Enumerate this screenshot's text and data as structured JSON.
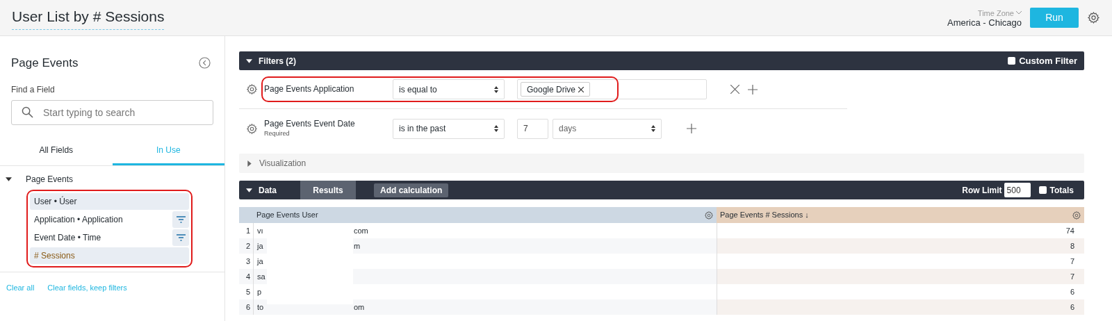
{
  "header": {
    "title": "User List by # Sessions",
    "time_zone_label": "Time Zone",
    "time_zone": "America - Chicago",
    "run_button": "Run"
  },
  "sidebar": {
    "title": "Page Events",
    "find_label": "Find a Field",
    "search": {
      "placeholder": "Start typing to search"
    },
    "tabs": [
      {
        "label": "All Fields",
        "selected": false
      },
      {
        "label": "In Use",
        "selected": true
      }
    ],
    "tree": {
      "label": "Page Events",
      "expanded": true,
      "children": [
        {
          "label": "User • Úser",
          "kind": "dimension",
          "selected": true,
          "filtered": false
        },
        {
          "label": "Application • Application",
          "kind": "dimension",
          "selected": false,
          "filtered": true
        },
        {
          "label": "Event Date • Time",
          "kind": "dimension",
          "selected": false,
          "filtered": true
        },
        {
          "label": "# Sessions",
          "kind": "measure",
          "selected": true,
          "filtered": false
        }
      ]
    },
    "links": [
      "Clear all",
      "Clear fields, keep filters"
    ]
  },
  "filters": {
    "title": "Filters (2)",
    "expanded": true,
    "custom_filter": {
      "label": "Custom Filter",
      "checked": false
    },
    "rows": [
      {
        "kind": "tags",
        "field": "Page Events Application",
        "operator": "is equal to",
        "tags": [
          "Google Drive"
        ],
        "highlighted": true
      },
      {
        "kind": "number_unit",
        "field": "Page Events Event Date",
        "note": "Required",
        "operator": "is in the past",
        "number": "7",
        "unit": "days",
        "highlighted": false
      }
    ]
  },
  "visualization": {
    "title": "Visualization",
    "expanded": false
  },
  "data": {
    "title": "Data",
    "expanded": true,
    "tabs": [
      {
        "label": "Results",
        "selected": true
      }
    ],
    "add_calculation": "Add calculation",
    "row_limit_label": "Row Limit",
    "row_limit": "500",
    "totals": {
      "label": "Totals",
      "checked": false
    },
    "columns": [
      "Page Events User",
      "Page Events # Sessions ↓"
    ],
    "rows": [
      {
        "index": "1",
        "user_start": "vı",
        "user_end": "com",
        "sessions": "74"
      },
      {
        "index": "2",
        "user_start": "ja",
        "user_end": "m",
        "sessions": "8"
      },
      {
        "index": "3",
        "user_start": "ja",
        "sessions": "7"
      },
      {
        "index": "4",
        "user_start": "sa",
        "sessions": "7"
      },
      {
        "index": "5",
        "user_start": "p",
        "sessions": "6"
      },
      {
        "index": "6",
        "user_start": "to",
        "user_end": "om",
        "sessions": "6"
      }
    ]
  }
}
